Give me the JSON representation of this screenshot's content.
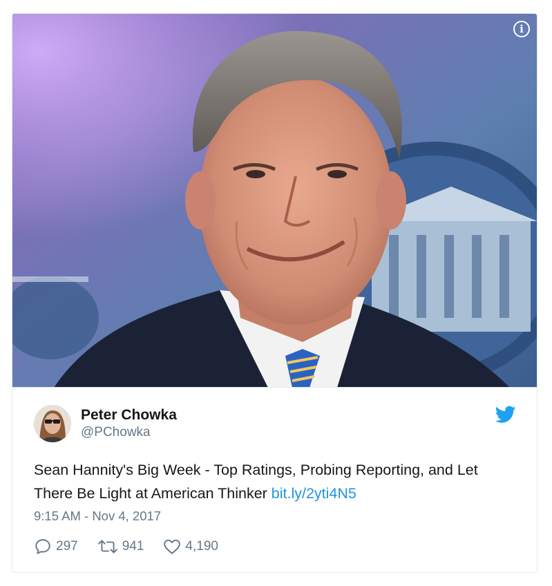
{
  "media": {
    "alt": "Photo of a man in a suit with a striped tie",
    "info_icon": "info-icon"
  },
  "author": {
    "display_name": "Peter Chowka",
    "handle": "@PChowka",
    "avatar_icon": "avatar"
  },
  "tweet": {
    "text": "Sean Hannity's Big Week - Top Ratings, Probing Reporting, and Let There Be Light at American Thinker ",
    "link_text": "bit.ly/2yti4N5",
    "timestamp": "9:15 AM - Nov 4, 2017"
  },
  "actions": {
    "replies": "297",
    "retweets": "941",
    "likes": "4,190"
  },
  "colors": {
    "link": "#1b95e0",
    "twitter_blue": "#1da1f2",
    "muted": "#657786",
    "text": "#14171a"
  }
}
